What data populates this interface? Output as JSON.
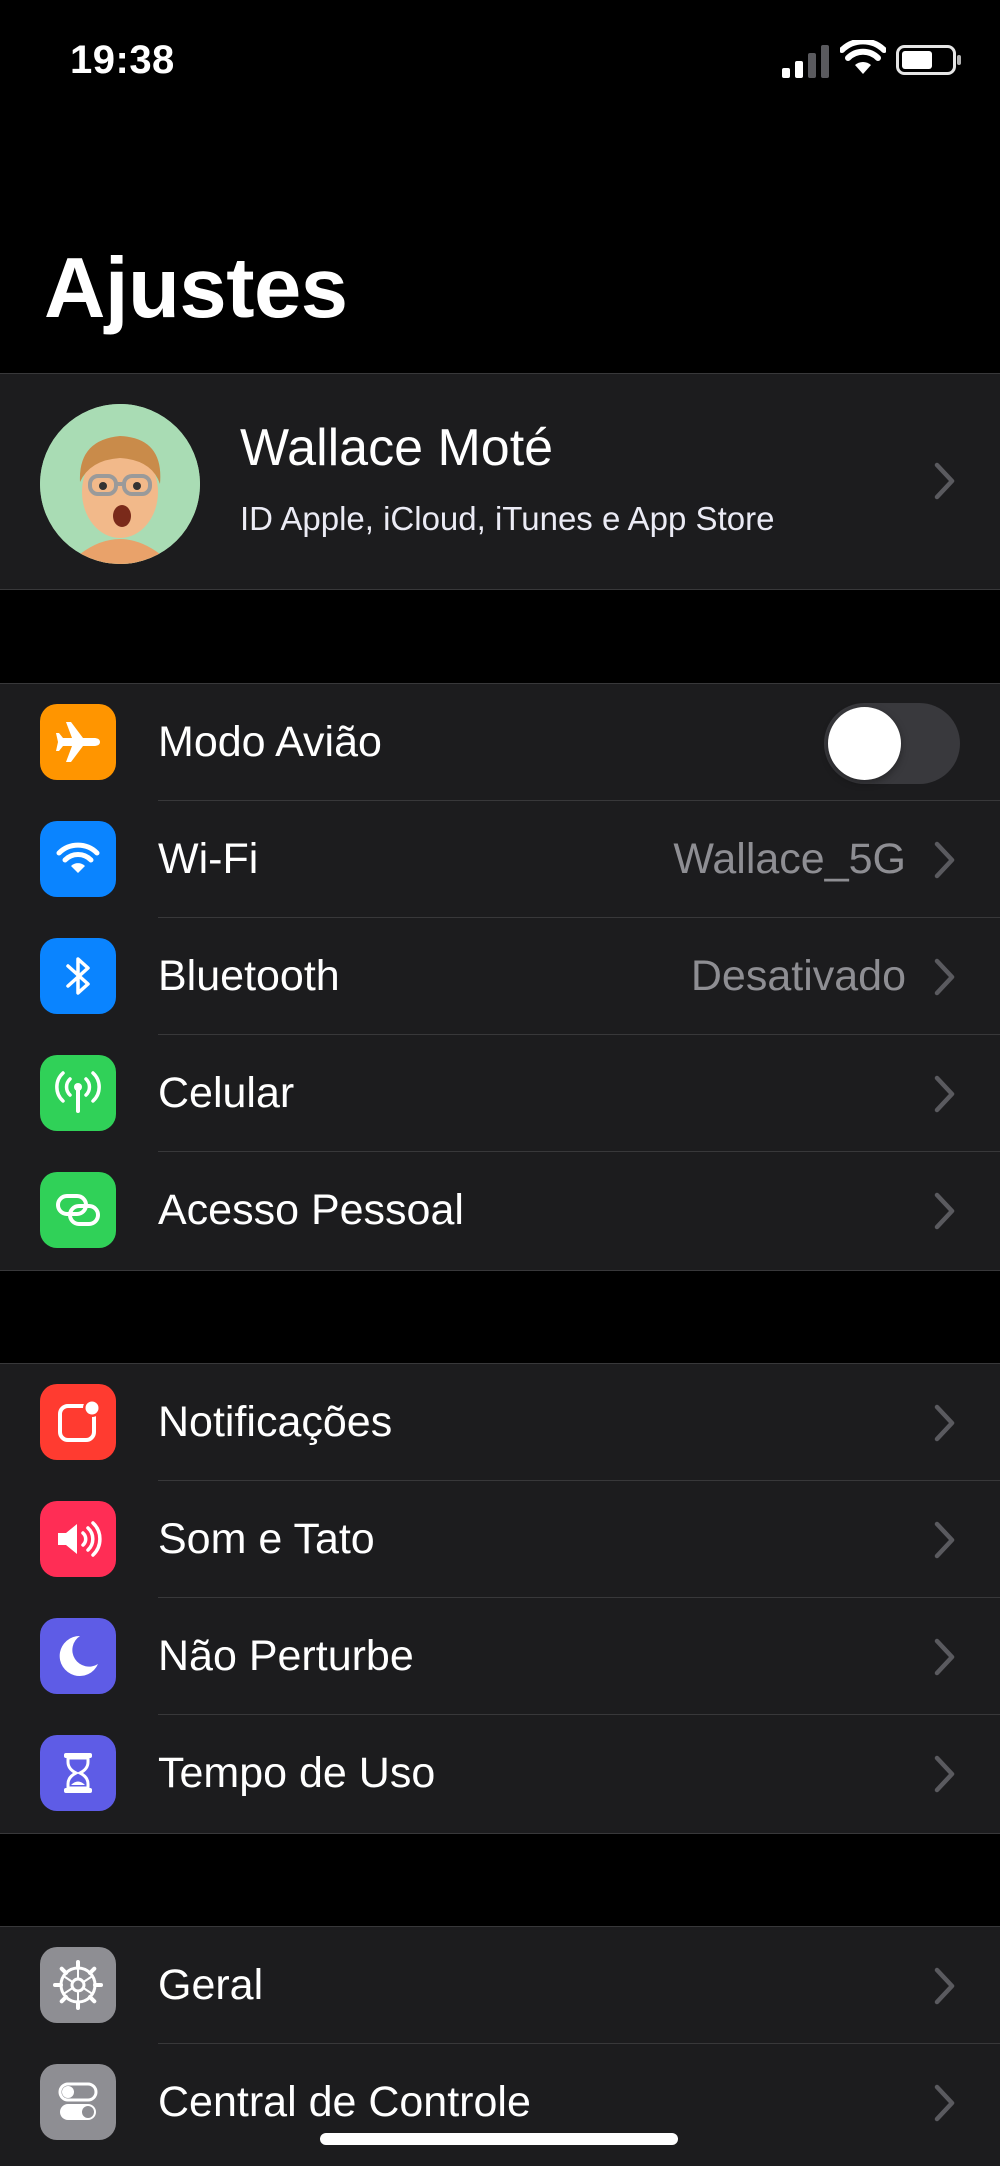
{
  "status_bar": {
    "time": "19:38"
  },
  "header": {
    "title": "Ajustes"
  },
  "profile": {
    "name": "Wallace Moté",
    "subtitle": "ID Apple, iCloud, iTunes e App Store"
  },
  "group1": [
    {
      "label": "Modo Avião",
      "icon": "airplane-icon",
      "color": "#ff9500",
      "toggle": false
    },
    {
      "label": "Wi-Fi",
      "icon": "wifi-icon",
      "color": "#0a84ff",
      "value": "Wallace_5G"
    },
    {
      "label": "Bluetooth",
      "icon": "bluetooth-icon",
      "color": "#0a84ff",
      "value": "Desativado"
    },
    {
      "label": "Celular",
      "icon": "antenna-icon",
      "color": "#30d158"
    },
    {
      "label": "Acesso Pessoal",
      "icon": "chain-link-icon",
      "color": "#30d158"
    }
  ],
  "group2": [
    {
      "label": "Notificações",
      "icon": "notifications-icon",
      "color": "#ff3b30"
    },
    {
      "label": "Som e Tato",
      "icon": "speaker-icon",
      "color": "#ff2d55"
    },
    {
      "label": "Não Perturbe",
      "icon": "moon-icon",
      "color": "#5e5ce6"
    },
    {
      "label": "Tempo de Uso",
      "icon": "hourglass-icon",
      "color": "#5e5ce6"
    }
  ],
  "group3": [
    {
      "label": "Geral",
      "icon": "gear-icon",
      "color": "#8e8e93"
    },
    {
      "label": "Central de Controle",
      "icon": "switches-icon",
      "color": "#8e8e93"
    }
  ]
}
